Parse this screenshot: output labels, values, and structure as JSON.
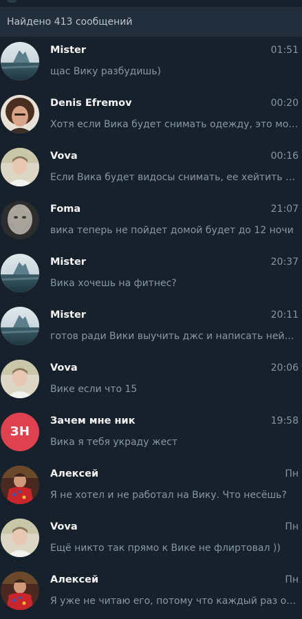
{
  "header": {
    "found_text": "Найдено 413 сообщений"
  },
  "messages": [
    {
      "name": "Mister",
      "time": "01:51",
      "text": "щас Вику разбудишь)",
      "avatar": "sea"
    },
    {
      "name": "Denis Efremov",
      "time": "00:20",
      "text": "Хотя если Вика будет снимать одежду, это может",
      "avatar": "denis"
    },
    {
      "name": "Vova",
      "time": "00:16",
      "text": "Если Вика будет видосы снимать, ее хейтить будут",
      "avatar": "vova"
    },
    {
      "name": "Foma",
      "time": "21:07",
      "text": "вика теперь не пойдет домой будет до 12 ночи",
      "avatar": "statue"
    },
    {
      "name": "Mister",
      "time": "20:37",
      "text": "Вика хочешь на фитнес?",
      "avatar": "sea"
    },
    {
      "name": "Mister",
      "time": "20:11",
      "text": "готов ради Вики выучить джс и написать нейронку",
      "avatar": "sea"
    },
    {
      "name": "Vova",
      "time": "20:06",
      "text": "Вике если что 15",
      "avatar": "vova"
    },
    {
      "name": "Зачем мне ник",
      "time": "19:58",
      "text": "Вика я тебя украду жест",
      "avatar": "initials",
      "initials": "ЗН",
      "avatar_color": "#e0414f"
    },
    {
      "name": "Алексей",
      "time": "Пн",
      "text": "Я не хотел и не работал на Вику. Что несёшь?",
      "avatar": "alexey"
    },
    {
      "name": "Vova",
      "time": "Пн",
      "text": "Ещё никто так прямо к Вике не флиртовал ))",
      "avatar": "vova"
    },
    {
      "name": "Алексей",
      "time": "Пн",
      "text": "Я уже не читаю его, потому что каждый раз одно и то же",
      "avatar": "alexey"
    }
  ]
}
